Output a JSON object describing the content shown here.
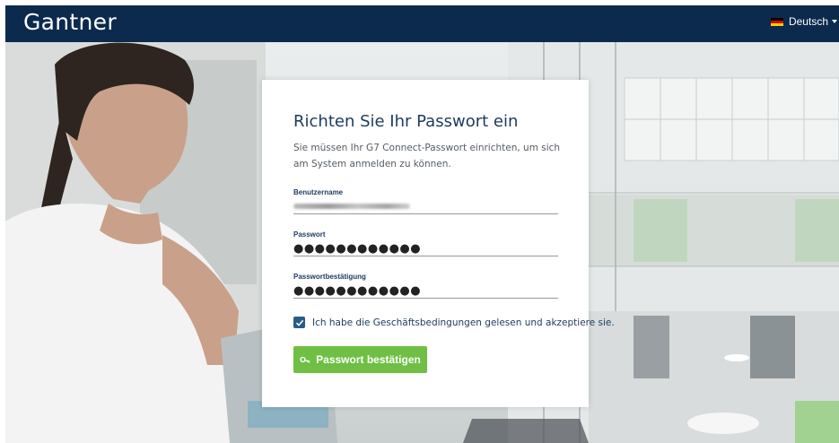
{
  "header": {
    "logo_text": "Gantner",
    "language": {
      "label": "Deutsch",
      "flag_colors": [
        "#000000",
        "#dd0000",
        "#ffce00"
      ]
    }
  },
  "card": {
    "title": "Richten Sie Ihr Passwort ein",
    "intro": "Sie müssen Ihr G7 Connect-Passwort einrichten, um sich am System anmelden zu können.",
    "fields": [
      {
        "label": "Benutzername",
        "value": ""
      },
      {
        "label": "Passwort",
        "value": "●●●●●●●●●●●●"
      },
      {
        "label": "Passwortbestätigung",
        "value": "●●●●●●●●●●●●"
      }
    ],
    "terms": {
      "label": "Ich habe die Geschäftsbedingungen gelesen und akzeptiere sie.",
      "checked": true
    },
    "submit_label": "Passwort bestätigen"
  },
  "colors": {
    "header_bg": "#0b2a4d",
    "accent_green": "#6fbf45",
    "checkbox": "#2b5b8c",
    "title": "#1d3a5f"
  }
}
